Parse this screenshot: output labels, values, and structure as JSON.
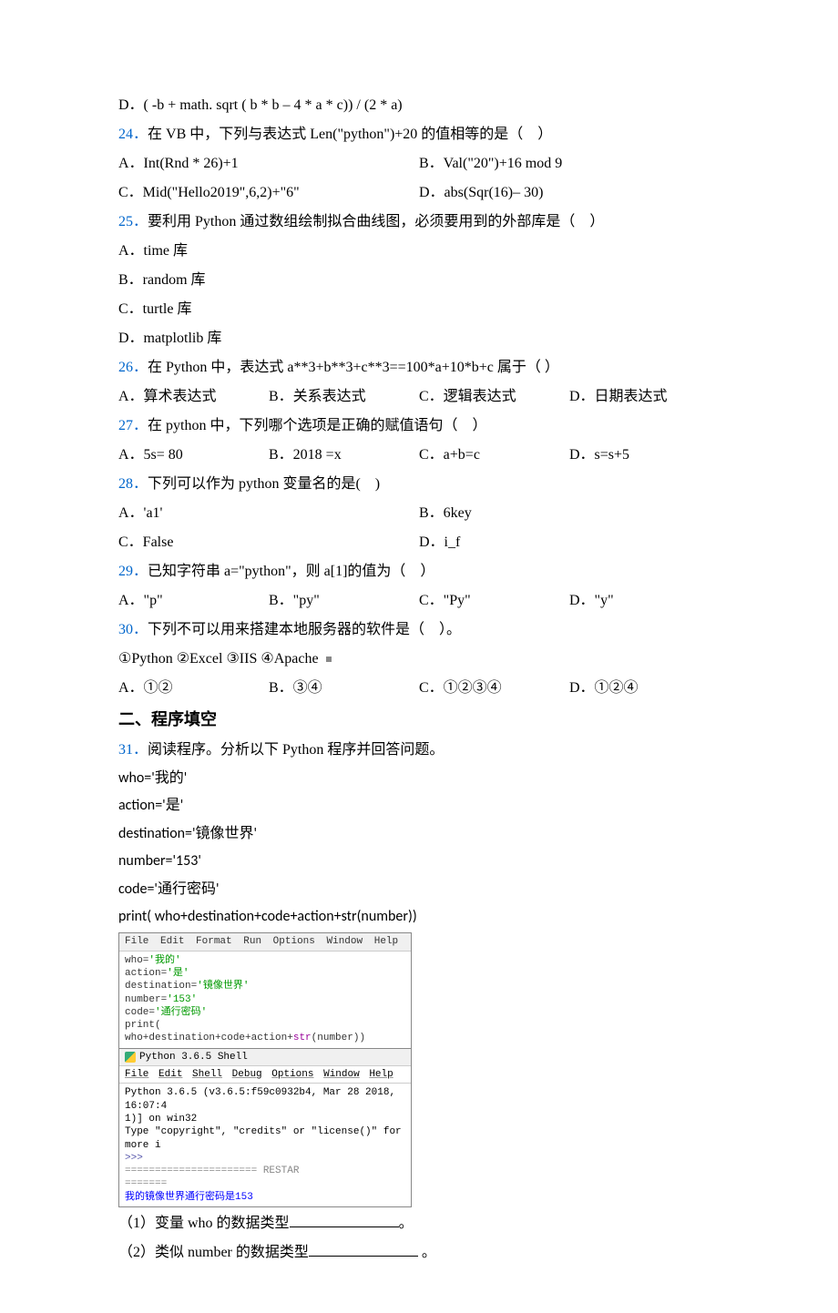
{
  "q23_d": "D．( -b + math. sqrt ( b * b – 4 * a * c)) / (2 * a)",
  "q24": {
    "num": "24．",
    "text": "在 VB 中，下列与表达式 Len(\"python\")+20 的值相等的是（　）",
    "a": "A．Int(Rnd * 26)+1",
    "b": "B．Val(\"20\")+16 mod 9",
    "c": "C．Mid(\"Hello2019\",6,2)+\"6\"",
    "d": "D．abs(Sqr(16)– 30)"
  },
  "q25": {
    "num": "25．",
    "text": "要利用 Python 通过数组绘制拟合曲线图，必须要用到的外部库是（　）",
    "a": "A．time 库",
    "b": "B．random 库",
    "c": "C．turtle 库",
    "d": "D．matplotlib 库"
  },
  "q26": {
    "num": "26．",
    "text": "在 Python 中，表达式 a**3+b**3+c**3==100*a+10*b+c 属于（ ）",
    "a": "A．算术表达式",
    "b": "B．关系表达式",
    "c": "C．逻辑表达式",
    "d": "D．日期表达式"
  },
  "q27": {
    "num": "27．",
    "text": "在 python 中，下列哪个选项是正确的赋值语句（　）",
    "a": "A．5s= 80",
    "b": "B．2018 =x",
    "c": "C．a+b=c",
    "d": "D．s=s+5"
  },
  "q28": {
    "num": "28．",
    "text": "下列可以作为 python 变量名的是(　)",
    "a": "A．'a1'",
    "b": "B．6key",
    "c": "C．False",
    "d": "D．i_f"
  },
  "q29": {
    "num": "29．",
    "text": "已知字符串 a=\"python\"，则 a[1]的值为（　）",
    "a": "A．\"p\"",
    "b": "B．\"py\"",
    "c": "C．\"Py\"",
    "d": "D．\"y\""
  },
  "q30": {
    "num": "30．",
    "text": "下列不可以用来搭建本地服务器的软件是（　）。",
    "list": "①Python ②Excel ③IIS ④Apache",
    "a": "A．①②",
    "b": "B．③④",
    "c": "C．①②③④",
    "d": "D．①②④"
  },
  "section2": "二、程序填空",
  "q31": {
    "num": "31．",
    "text": "阅读程序。分析以下 Python 程序并回答问题。",
    "code1": "who='我的'",
    "code2": "action='是'",
    "code3": "destination='镜像世界'",
    "code4": "number='153'",
    "code5": "code='通行密码'",
    "code6": "print( who+destination+code+action+str(number))"
  },
  "ide": {
    "menu": {
      "file": "File",
      "edit": "Edit",
      "format": "Format",
      "run": "Run",
      "options": "Options",
      "window": "Window",
      "help": "Help"
    },
    "l1a": "who=",
    "l1b": "'我的'",
    "l2a": "action=",
    "l2b": "'是'",
    "l3a": "destination=",
    "l3b": "'镜像世界'",
    "l4a": "number=",
    "l4b": "'153'",
    "l5a": "code=",
    "l5b": "'通行密码'",
    "l6": "print( who+destination+code+action+",
    "l6s": "str",
    "l6e": "(number))",
    "shelltitle": "Python 3.6.5 Shell",
    "menu2": {
      "file": "File",
      "edit": "Edit",
      "shell": "Shell",
      "debug": "Debug",
      "options": "Options",
      "window": "Window",
      "help": "Help"
    },
    "shl1": "Python 3.6.5 (v3.6.5:f59c0932b4, Mar 28 2018, 16:07:4",
    "shl2": "1)] on win32",
    "shl3": "Type \"copyright\", \"credits\" or \"license()\" for more i",
    "prompt": ">>>",
    "restart": "====================== RESTAR",
    "sep": "=======",
    "output": "我的镜像世界通行密码是153"
  },
  "sub1a": "（1）变量 who 的数据类型",
  "sub1b": "。",
  "sub2a": "（2）类似 number 的数据类型",
  "sub2b": " 。"
}
